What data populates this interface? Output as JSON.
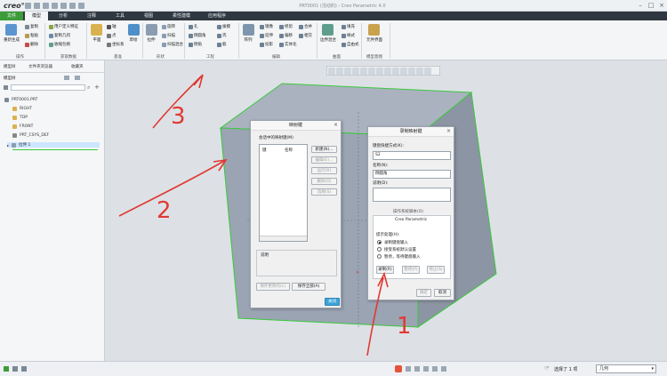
{
  "app": {
    "logo": "creo°",
    "window_title": "PRT0001 (活动的) - Creo Parametric 4.0"
  },
  "tabs": [
    {
      "label": "文件"
    },
    {
      "label": "模型"
    },
    {
      "label": "分析"
    },
    {
      "label": "注释"
    },
    {
      "label": "工具"
    },
    {
      "label": "视图"
    },
    {
      "label": "柔性建模"
    },
    {
      "label": "应用程序"
    }
  ],
  "ribbon": {
    "regenerate": "重新生成",
    "copy": "复制",
    "paste": "粘贴",
    "delete": "删除",
    "user_feature": "用户定义特征",
    "copy_geometry": "复制几何",
    "shrinkwrap": "收缩包络",
    "plane": "平面",
    "axis": "轴",
    "point": "点",
    "coord_sys": "坐标系",
    "sketch": "草绘",
    "extrude": "拉伸",
    "revolve": "旋转",
    "sweep": "扫描",
    "swept_blend": "扫描混合",
    "hole": "孔",
    "round": "倒圆角",
    "chamfer": "倒角",
    "draft": "拔模",
    "shell": "壳",
    "rib": "筋",
    "pattern": "阵列",
    "mirror": "镜像",
    "extend": "延伸",
    "project": "投影",
    "trim": "修剪",
    "offset": "偏移",
    "merge": "合并",
    "intersect": "相交",
    "solidify": "实体化",
    "boundary_blend": "边界混合",
    "fill": "填充",
    "style": "样式",
    "freestyle": "自由式",
    "component_interface": "元件界面",
    "groups": {
      "operations": "操作",
      "get_data": "获取数据",
      "datum": "基准",
      "shapes": "形状",
      "engineering": "工程",
      "editing": "编辑",
      "surfaces": "曲面",
      "model_intent": "模型意图"
    }
  },
  "left_panel": {
    "tabs": [
      "模型树",
      "文件夹浏览器",
      "收藏夹"
    ],
    "tree_label": "模型树",
    "items": [
      {
        "label": "PRT0001.PRT"
      },
      {
        "label": "RIGHT"
      },
      {
        "label": "TOP"
      },
      {
        "label": "FRONT"
      },
      {
        "label": "PRT_CSYS_DEF"
      },
      {
        "label": "拉伸 1"
      }
    ]
  },
  "mapkeys_dialog": {
    "title": "映射键",
    "section_label": "会话中的映射键(M)",
    "col_key": "键",
    "col_name": "名称",
    "buttons": {
      "new": "新建(N)...",
      "edit": "编辑(E)...",
      "run": "运行(R)",
      "delete": "删除(D)",
      "delete_all": "选择(S)",
      "save_changed": "保存更改的(C)",
      "save_all": "保存全部(A)",
      "close": "关闭"
    },
    "desc_label": "说明"
  },
  "record_dialog": {
    "title": "录制映射键",
    "key_seq_label": "键盘快捷方式(K):",
    "key_seq_value": "S2",
    "name_label": "名称(N):",
    "name_value": "倒圆角",
    "desc_label": "说明(D):",
    "env_label": "操作系统脚本(O)",
    "creo_label": "Creo Parametric",
    "prompt_label": "提示处理(H):",
    "options": [
      {
        "label": "录制键盘输入",
        "selected": true
      },
      {
        "label": "接受系统默认设置",
        "selected": false
      },
      {
        "label": "暂停，等待键盘输入",
        "selected": false
      }
    ],
    "btn_record": "录制(R)",
    "btn_pause": "暂停(P)",
    "btn_stop": "停止(S)",
    "btn_ok": "确定",
    "btn_cancel": "取消"
  },
  "statusbar": {
    "selection": "选择了 1 项",
    "filter": "几何"
  },
  "annotations": [
    "1",
    "2",
    "3"
  ],
  "colors": {
    "accent_green": "#3d9c3a",
    "annotation_red": "#e03a33",
    "model_face": "#9aa4b3",
    "model_edge": "#3cc83c"
  }
}
